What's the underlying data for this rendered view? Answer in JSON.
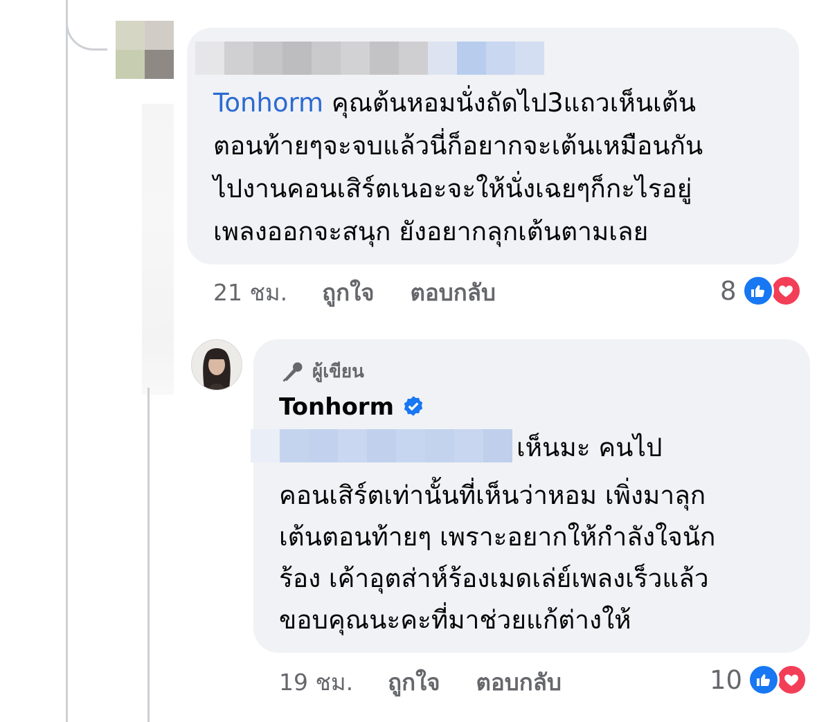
{
  "comments": [
    {
      "mention": "Tonhorm",
      "text_lines": [
        " คุณต้นหอมนั่งถัดไป3แถวเห็นเต้น",
        "ตอนท้ายๆจะจบแล้วนี่ก็อยากจะเต้นเหมือนกัน",
        "ไปงานคอนเสิร์ตเนอะจะให้นั่งเฉยๆก็กะไรอยู่",
        "เพลงออกจะสนุก ยังอยากลุกเต้นตามเลย"
      ],
      "time": "21 ชม.",
      "like_label": "ถูกใจ",
      "reply_label": "ตอบกลับ",
      "reaction_count": "8",
      "reactions": [
        "like-icon",
        "love-icon"
      ]
    },
    {
      "author_badge": "ผู้เขียน",
      "author_name": "Tonhorm",
      "verified": true,
      "first_line": "เห็นมะ คนไป",
      "text_lines": [
        "คอนเสิร์ตเท่านั้นที่เห็นว่าหอม เพิ่งมาลุก",
        "เต้นตอนท้ายๆ เพราะอยากให้กำลังใจนัก",
        "ร้อง เค้าอุตส่าห์ร้องเมดเล่ย์เพลงเร็วแล้ว",
        "ขอบคุณนะคะที่มาช่วยแก้ต่างให้"
      ],
      "time": "19 ชม.",
      "like_label": "ถูกใจ",
      "reply_label": "ตอบกลับ",
      "reaction_count": "10",
      "reactions": [
        "like-icon",
        "love-icon"
      ]
    }
  ],
  "colors": {
    "bubble": "#f0f2f5",
    "mention": "#2c6ad2",
    "meta": "#65676b",
    "like": "#1877f2",
    "love": "#f33e58",
    "verified": "#1877f2"
  }
}
